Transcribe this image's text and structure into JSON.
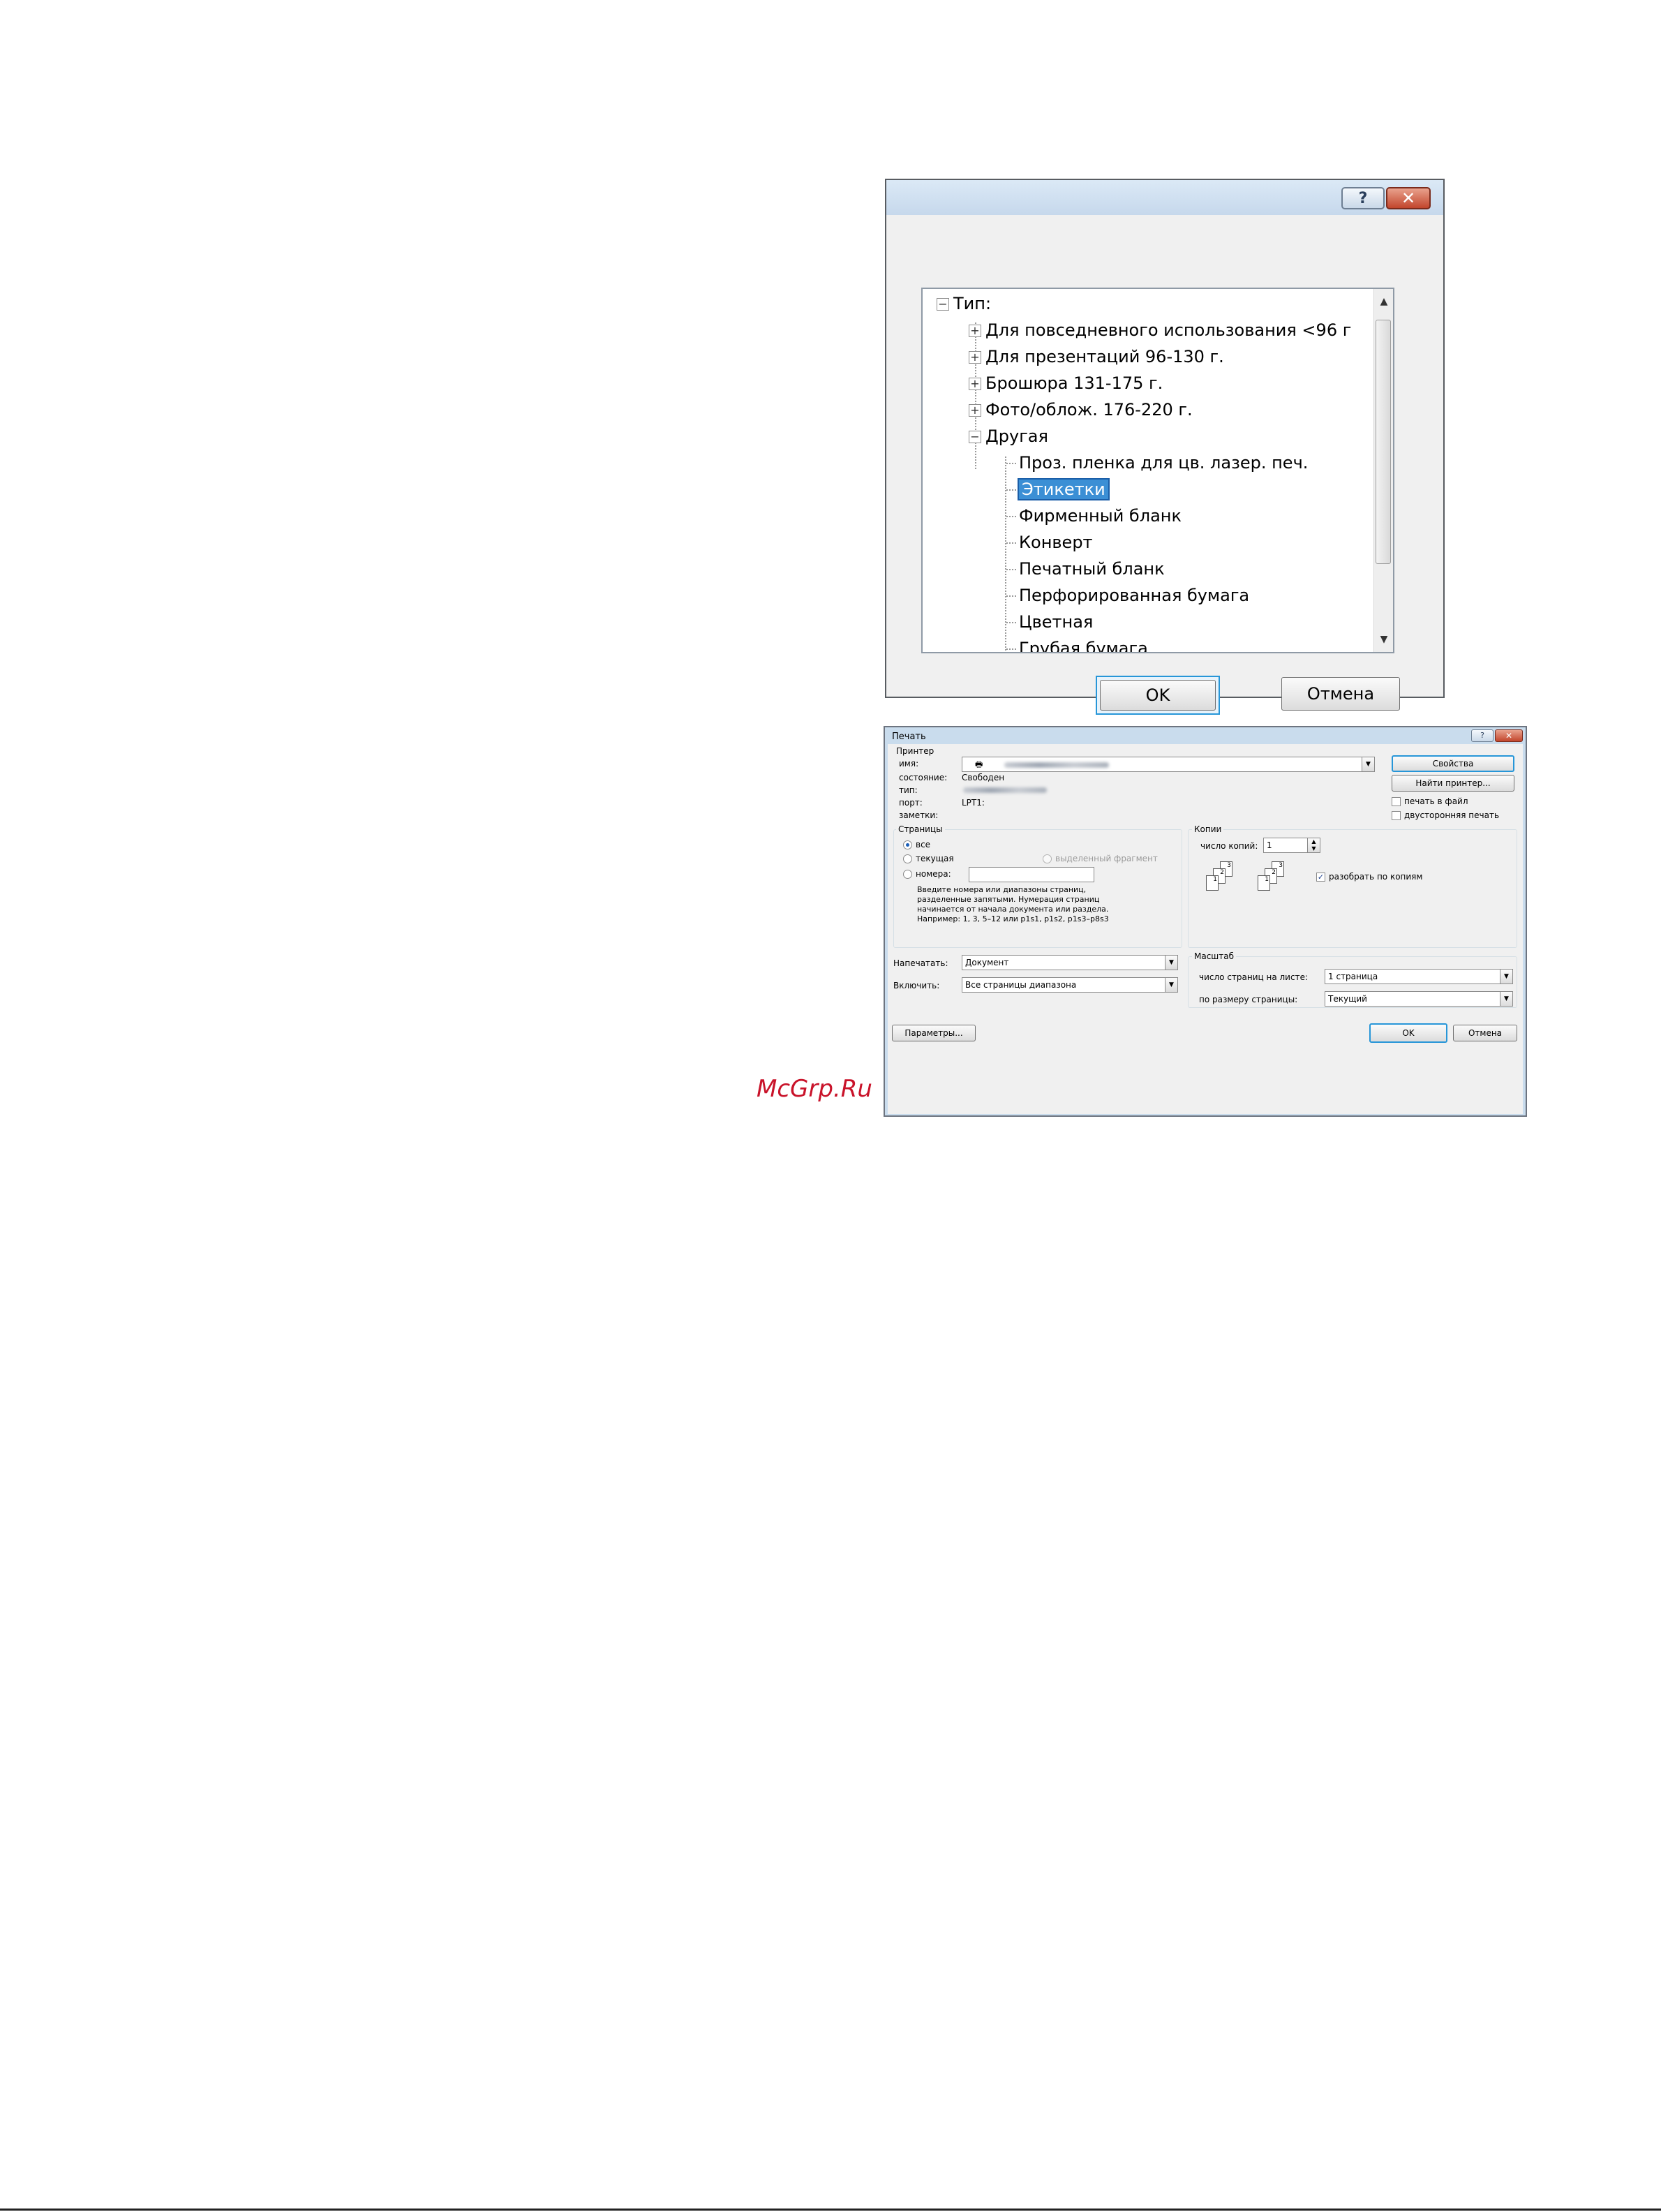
{
  "type_dialog": {
    "help_label": "?",
    "close_label": "✕",
    "tree": {
      "root": "Тип:",
      "groups": [
        "Для повседневного использования <96 г",
        "Для презентаций 96-130 г.",
        "Брошюра 131-175 г.",
        "Фото/облож. 176-220 г.",
        "Другая"
      ],
      "items": [
        "Проз. пленка для цв. лазер. печ.",
        "Этикетки",
        "Фирменный бланк",
        "Конверт",
        "Печатный бланк",
        "Перфорированная бумага",
        "Цветная",
        "Грубая бумага"
      ],
      "selected": "Этикетки"
    },
    "ok_label": "OK",
    "cancel_label": "Отмена"
  },
  "print_dialog": {
    "title": "Печать",
    "help_label": "?",
    "close_label": "✕",
    "printer": {
      "group_title": "Принтер",
      "name_label": "имя:",
      "status_label": "состояние:",
      "status_value": "Свободен",
      "type_label": "тип:",
      "port_label": "порт:",
      "port_value": "LPT1:",
      "notes_label": "заметки:",
      "properties_button": "Свойства",
      "find_printer_button": "Найти принтер...",
      "print_to_file_label": "печать в файл",
      "duplex_label": "двусторонняя печать"
    },
    "pages": {
      "group_title": "Страницы",
      "all_label": "все",
      "current_label": "текущая",
      "selection_label": "выделенный фрагмент",
      "numbers_label": "номера:",
      "hint_lines": [
        "Введите номера или диапазоны страниц,",
        "разделенные запятыми. Нумерация страниц",
        "начинается от начала документа или раздела.",
        "Например: 1, 3, 5–12 или p1s1, p1s2, p1s3–p8s3"
      ]
    },
    "copies": {
      "group_title": "Копии",
      "count_label": "число копий:",
      "count_value": "1",
      "collate_label": "разобрать по копиям",
      "stack_a": [
        "3",
        "2",
        "1"
      ],
      "stack_b": [
        "3",
        "2",
        "1"
      ]
    },
    "print_what_label": "Напечатать:",
    "print_what_value": "Документ",
    "include_label": "Включить:",
    "include_value": "Все страницы диапазона",
    "zoom": {
      "group_title": "Масштаб",
      "pages_per_sheet_label": "число страниц на листе:",
      "pages_per_sheet_value": "1 страница",
      "scale_label": "по размеру страницы:",
      "scale_value": "Текущий"
    },
    "options_button": "Параметры...",
    "ok_button": "OK",
    "cancel_button": "Отмена"
  },
  "watermark": "McGrp.Ru"
}
